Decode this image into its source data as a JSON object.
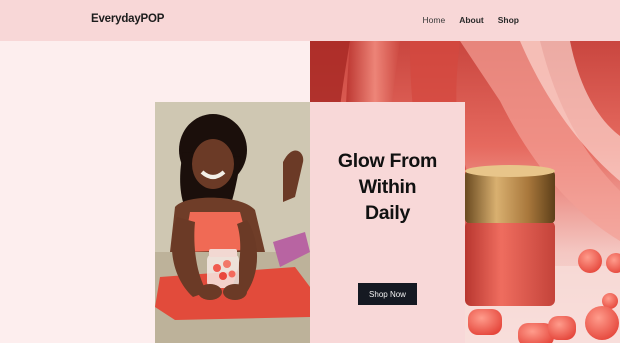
{
  "header": {
    "logo": "EverydayPOP",
    "nav": [
      {
        "label": "Home",
        "active": true
      },
      {
        "label": "About",
        "active": false
      },
      {
        "label": "Shop",
        "active": false
      }
    ]
  },
  "hero": {
    "headline": [
      "Glow From",
      "Within",
      "Daily"
    ],
    "cta_label": "Shop Now"
  },
  "colors": {
    "header_bg": "#f8d7d7",
    "page_bg": "#fdeeee",
    "card_bg": "#f8d8d8",
    "button_bg": "#151922"
  }
}
